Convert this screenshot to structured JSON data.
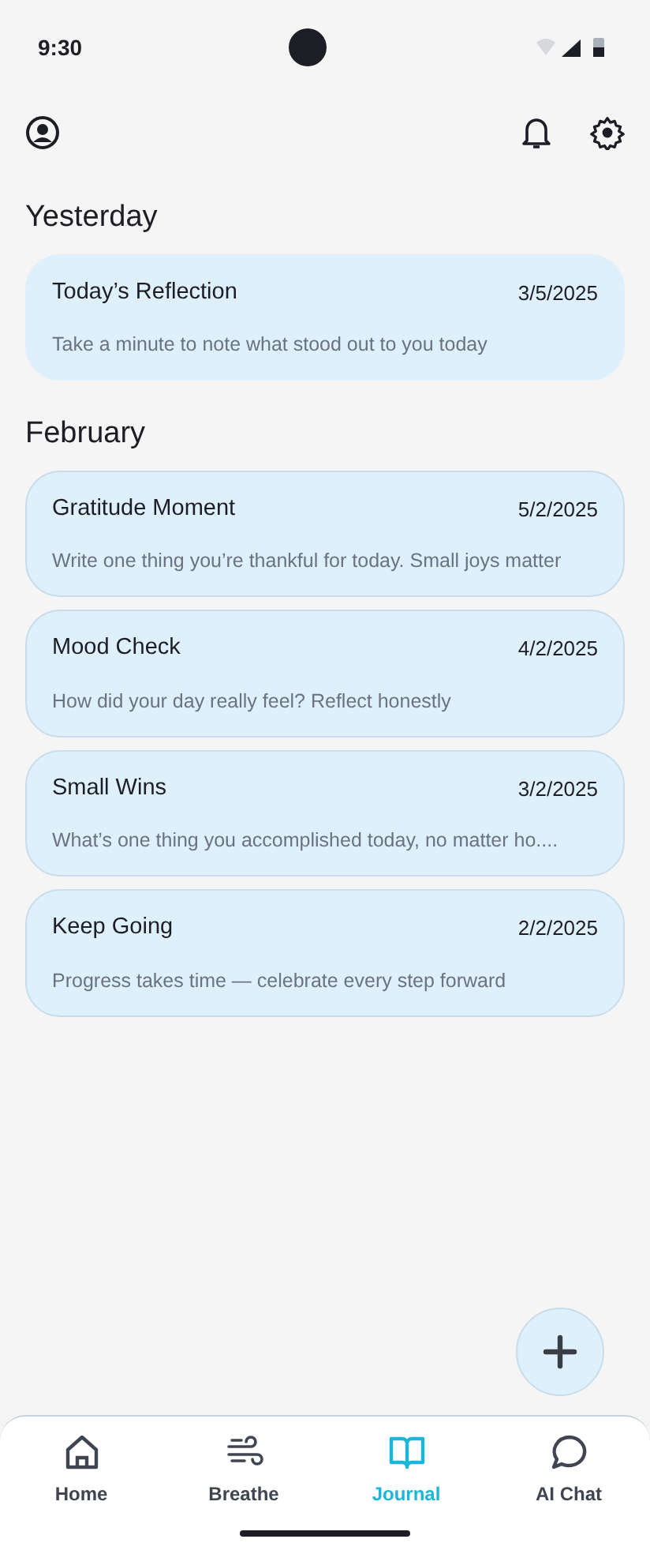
{
  "status_bar": {
    "time": "9:30"
  },
  "sections": [
    {
      "title": "Yesterday",
      "entries": [
        {
          "title": "Today’s Reflection",
          "date": "3/5/2025",
          "preview": "Take a minute to note what stood out to you today"
        }
      ]
    },
    {
      "title": "February",
      "entries": [
        {
          "title": "Gratitude Moment",
          "date": "5/2/2025",
          "preview": "Write one thing you’re thankful for today. Small joys matter"
        },
        {
          "title": "Mood Check",
          "date": "4/2/2025",
          "preview": "How did your day really feel? Reflect honestly"
        },
        {
          "title": "Small Wins",
          "date": "3/2/2025",
          "preview": "What’s one thing you accomplished today, no matter ho...."
        },
        {
          "title": "Keep Going",
          "date": "2/2/2025",
          "preview": "Progress takes time — celebrate every step forward"
        }
      ]
    }
  ],
  "nav": [
    {
      "label": "Home",
      "kind": "home",
      "selected": false
    },
    {
      "label": "Breathe",
      "kind": "breathe",
      "selected": false
    },
    {
      "label": "Journal",
      "kind": "journal",
      "selected": true
    },
    {
      "label": "AI Chat",
      "kind": "chat",
      "selected": false
    }
  ]
}
